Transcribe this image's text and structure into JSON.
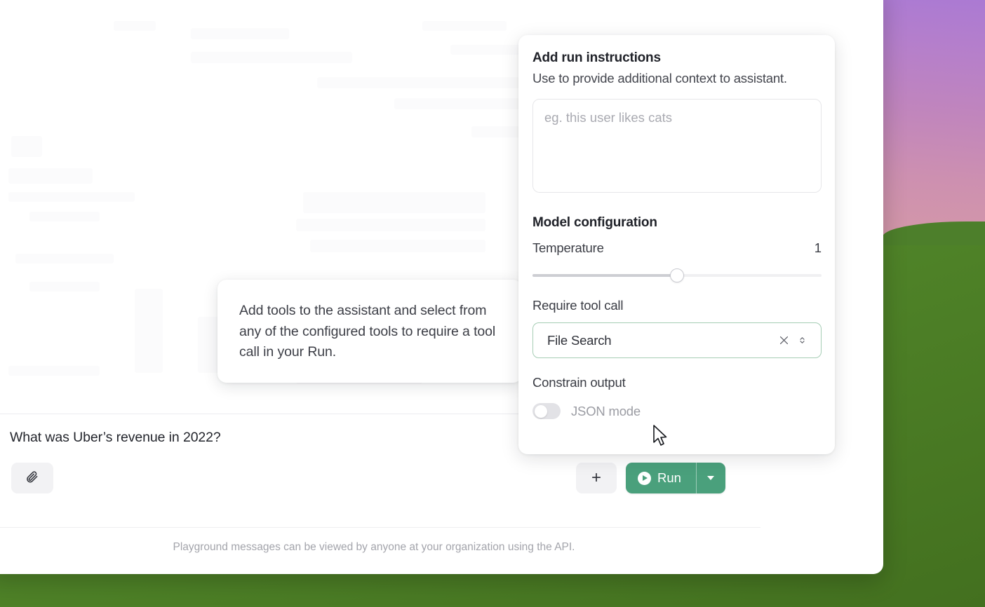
{
  "thread": {
    "user_message": "What was Uber’s revenue in 2022?",
    "attach_icon": "paperclip-icon",
    "add_icon": "plus-icon",
    "add_label": "+",
    "run_label": "Run",
    "run_dropdown_icon": "chevron-down-icon",
    "footer_note": "Playground messages can be viewed by anyone at your organization using the API."
  },
  "tooltip": {
    "text": "Add tools to the assistant and select from any of the configured tools to require a tool call in your Run."
  },
  "settings": {
    "instructions_title": "Add run instructions",
    "instructions_subtitle": "Use to provide additional context to assistant.",
    "instructions_placeholder": "eg. this user likes cats",
    "instructions_value": "",
    "model_config_title": "Model configuration",
    "temperature_label": "Temperature",
    "temperature_value": "1",
    "temperature_percent": 50,
    "require_tool_call_label": "Require tool call",
    "tool_select_value": "File Search",
    "tool_clear_icon": "close-icon",
    "tool_chevrons_icon": "chevron-up-down-icon",
    "constrain_output_label": "Constrain output",
    "json_mode_label": "JSON mode",
    "json_mode_enabled": false
  },
  "colors": {
    "accent_green": "#4aa07c",
    "select_border_green": "#a6cdb5",
    "text_primary": "#1f2128",
    "text_secondary": "#3a3c44",
    "text_muted": "#a3a4ab",
    "wallpaper_green": "#4f8328",
    "wallpaper_purple": "#b07fd0"
  }
}
